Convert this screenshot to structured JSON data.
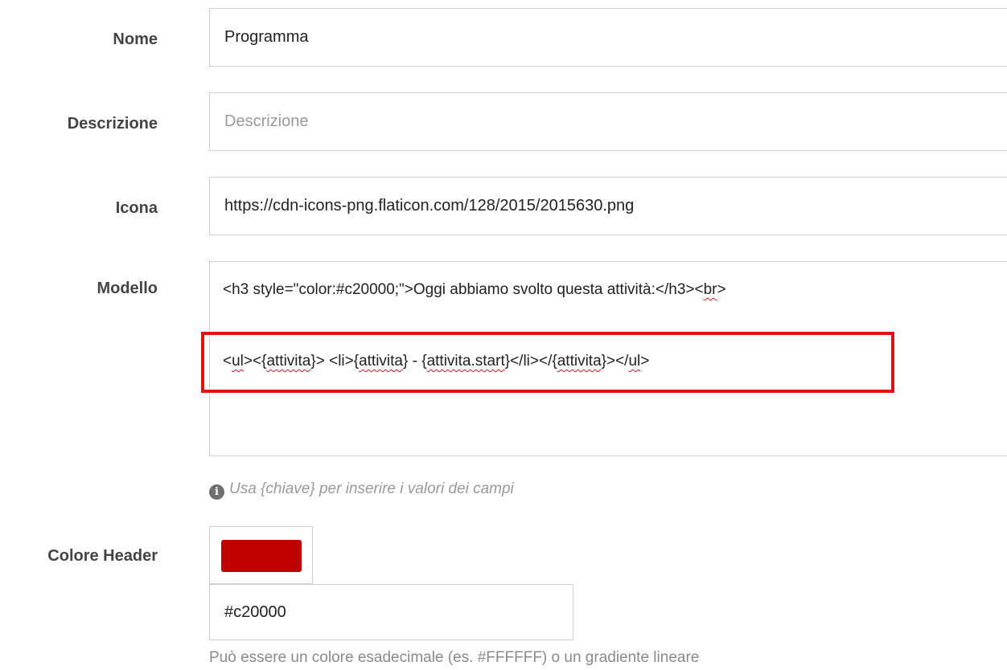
{
  "form": {
    "nome": {
      "label": "Nome",
      "value": "Programma"
    },
    "descrizione": {
      "label": "Descrizione",
      "value": "",
      "placeholder": "Descrizione"
    },
    "icona": {
      "label": "Icona",
      "value": "https://cdn-icons-png.flaticon.com/128/2015/2015630.png"
    },
    "modello": {
      "label": "Modello",
      "line1": {
        "a": "<h3 style=\"color:#c20000;\">Oggi abbiamo svolto questa attività:</h3><",
        "b": "br",
        "c": ">"
      },
      "line2": {
        "p1": "<",
        "w1": "ul",
        "p2": "><{",
        "w2": "attivita",
        "p3": "}> <li>{",
        "w3": "attivita",
        "p4": "} - {",
        "w4": "attivita.start",
        "p5": "}</li></{",
        "w5": "attivita",
        "p6": "}></",
        "w6": "ul",
        "p7": ">"
      },
      "hint_icon": "info-circle-icon",
      "hint_glyph": "i",
      "hint": "Usa {chiave} per inserire i valori dei campi"
    },
    "colore_header": {
      "label": "Colore Header",
      "swatch_color": "#c20000",
      "value": "#c20000",
      "help": "Può essere un colore esadecimale (es. #FFFFFF) o un gradiente lineare"
    }
  },
  "colors": {
    "highlight": "#e31212",
    "accent": "#c20000",
    "spellcheck": "#d81b1b"
  }
}
